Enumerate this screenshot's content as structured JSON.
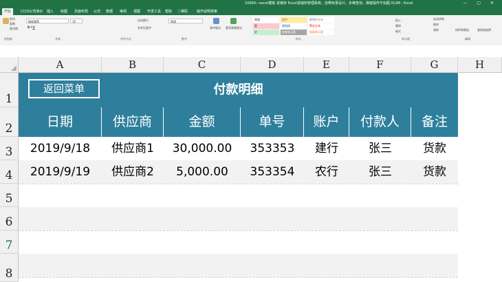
{
  "window": {
    "title": "10900---excel模板 进销存 Excel进销存管理系统，自带目录设计，多维查询，弹窗操作不加图.XLSM - Excel",
    "controls": "— ▢ ✕"
  },
  "ribbon_tabs": [
    "开始",
    "CCDI公司演示",
    "插入",
    "绘图",
    "页面布局",
    "公式",
    "数据",
    "审阅",
    "视图",
    "开发工具",
    "帮助",
    "二维码",
    "操作说明搜索"
  ],
  "ribbon": {
    "clipboard": {
      "cut": "剪切",
      "copy": "复制",
      "painter": "格式刷",
      "group": "剪贴板"
    },
    "font": {
      "name": "微软雅黑",
      "size": "10",
      "group": "字体"
    },
    "alignment": {
      "wrap": "自动换行",
      "merge": "合并后居中",
      "group": "对齐方式"
    },
    "number": {
      "format": "常规",
      "group": "数字"
    },
    "styles": {
      "cond_format": "条件格式",
      "table_format": "套用表格格式",
      "items": [
        {
          "label": "常规",
          "bg": "#ffffff",
          "fg": "#333333"
        },
        {
          "label": "差",
          "bg": "#ffc7ce",
          "fg": "#9c0006"
        },
        {
          "label": "好",
          "bg": "#c6efce",
          "fg": "#006100"
        },
        {
          "label": "适中",
          "bg": "#ffeb9c",
          "fg": "#9c5700"
        },
        {
          "label": "超链接",
          "bg": "#ffffff",
          "fg": "#0563c1"
        },
        {
          "label": "检查单元格",
          "bg": "#a5a5a5",
          "fg": "#ffffff"
        },
        {
          "label": "解释性文本",
          "bg": "#ffffff",
          "fg": "#7f7f7f"
        },
        {
          "label": "警告文本",
          "bg": "#ffffff",
          "fg": "#ff0000"
        },
        {
          "label": "链接单元格",
          "bg": "#ffffff",
          "fg": "#fa7d00"
        }
      ],
      "group": "样式"
    },
    "cells": {
      "insert": "插入",
      "delete": "删除",
      "format": "格式",
      "group": "单元格"
    },
    "editing": {
      "autosum": "自动求和",
      "fill": "填充",
      "clear": "清除",
      "sort": "排序和筛选",
      "find": "查找和选择",
      "group": "编辑"
    }
  },
  "columns": [
    "A",
    "B",
    "C",
    "D",
    "E",
    "F",
    "G",
    "H"
  ],
  "rows": [
    "1",
    "2",
    "3",
    "4",
    "5",
    "6",
    "7",
    "8"
  ],
  "sheet": {
    "back_button": "返回菜单",
    "title": "付款明细",
    "headers": [
      "日期",
      "供应商",
      "金额",
      "单号",
      "账户",
      "付款人",
      "备注"
    ],
    "records": [
      [
        "2019/9/18",
        "供应商1",
        "30,000.00",
        "353353",
        "建行",
        "张三",
        "货款"
      ],
      [
        "2019/9/19",
        "供应商2",
        "5,000.00",
        "353354",
        "农行",
        "张三",
        "货款"
      ]
    ]
  },
  "colors": {
    "excel_green": "#217346",
    "table_header": "#2e7f9c",
    "band": "#f2f2f2"
  }
}
